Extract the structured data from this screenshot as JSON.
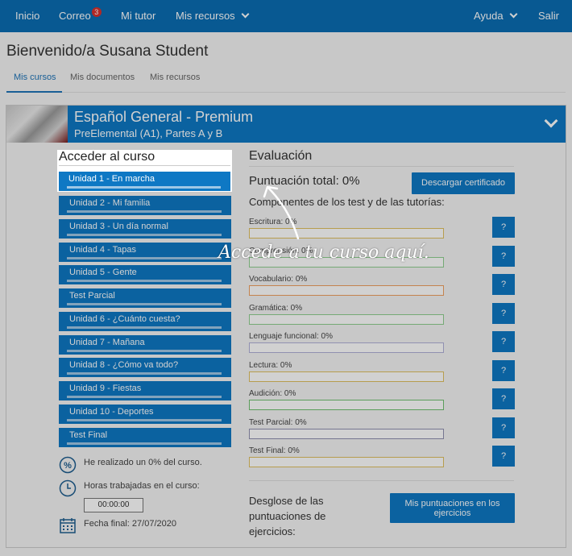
{
  "nav": {
    "inicio": "Inicio",
    "correo": "Correo",
    "correo_badge": "3",
    "tutor": "Mi tutor",
    "recursos": "Mis recursos",
    "ayuda": "Ayuda",
    "salir": "Salir"
  },
  "welcome": "Bienvenido/a Susana Student",
  "tabs": [
    "Mis cursos",
    "Mis documentos",
    "Mis recursos"
  ],
  "course": {
    "title": "Español General - Premium",
    "subtitle": "PreElemental (A1), Partes A y B"
  },
  "access": {
    "title": "Acceder al curso",
    "units": [
      "Unidad 1 - En marcha",
      "Unidad 2 - Mi familia",
      "Unidad 3 - Un día normal",
      "Unidad 4 - Tapas",
      "Unidad 5 - Gente",
      "Test Parcial",
      "Unidad 6 - ¿Cuánto cuesta?",
      "Unidad 7 - Mañana",
      "Unidad 8 - ¿Cómo va todo?",
      "Unidad 9 - Fiestas",
      "Unidad 10 - Deportes",
      "Test Final"
    ]
  },
  "stats": {
    "progress": "He realizado un 0% del curso.",
    "hours_label": "Horas trabajadas en el curso:",
    "hours_value": "00:00:00",
    "end_date": "Fecha final: 27/07/2020"
  },
  "evaluation": {
    "title": "Evaluación",
    "total": "Puntuación total: 0%",
    "cert_button": "Descargar certificado",
    "components_title": "Componentes de los test y de las tutorías:",
    "skills": [
      {
        "label": "Escritura: 0%",
        "value": 0,
        "color": "#e0c060"
      },
      {
        "label": "Comprensión: 0%",
        "value": 0,
        "color": "#8fd08f"
      },
      {
        "label": "Vocabulario: 0%",
        "value": 0,
        "color": "#f0a060"
      },
      {
        "label": "Gramática: 0%",
        "value": 0,
        "color": "#8fd08f"
      },
      {
        "label": "Lenguaje funcional: 0%",
        "value": 0,
        "color": "#b0b0d8"
      },
      {
        "label": "Lectura: 0%",
        "value": 0,
        "color": "#e0c060"
      },
      {
        "label": "Audición: 0%",
        "value": 0,
        "color": "#70c070"
      },
      {
        "label": "Test Parcial: 0%",
        "value": 0,
        "color": "#9090b0"
      },
      {
        "label": "Test Final: 0%",
        "value": 0,
        "color": "#e0c060"
      }
    ],
    "help_label": "?",
    "desglose": "Desglose de las puntuaciones de ejercicios:",
    "scores_button": "Mis puntuaciones en los ejercicios"
  },
  "tooltip": {
    "hint": "Accede a tu curso aquí."
  }
}
